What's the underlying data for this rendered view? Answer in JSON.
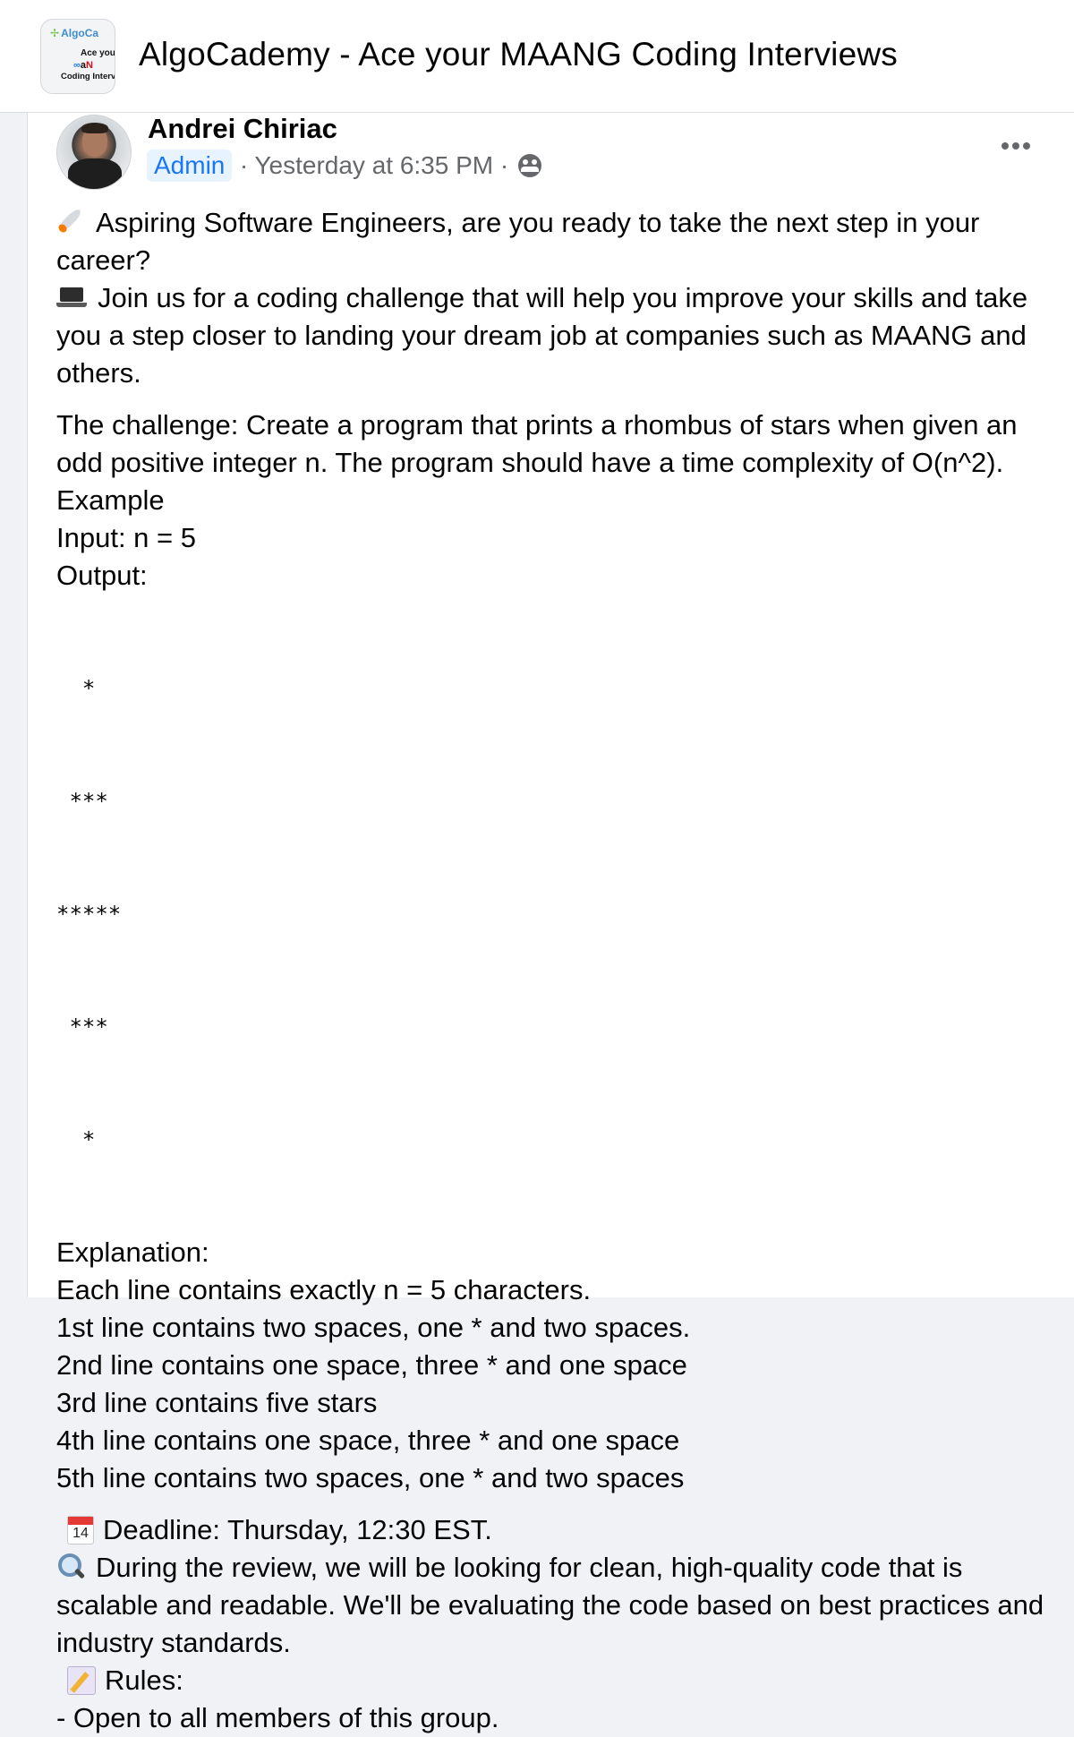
{
  "group": {
    "title": "AlgoCademy - Ace your MAANG Coding Interviews",
    "thumb": {
      "logo_text": "AlgoCa",
      "tagline": "Ace you",
      "brands": [
        "∞",
        "",
        "a",
        "N"
      ],
      "coding": "Coding Interv"
    }
  },
  "post": {
    "author": "Andrei Chiriac",
    "badge": "Admin",
    "timestamp": "· Yesterday at 6:35 PM ·",
    "icons": {
      "more": "more-options-icon",
      "audience": "group-audience-icon"
    },
    "paragraphs": {
      "intro1": "Aspiring Software Engineers, are you ready to take the next step in your career?",
      "intro2": "Join us for a coding challenge that will help you improve your skills and take you a step closer to landing your dream job at companies such as MAANG and others.",
      "challenge": "The challenge: Create a program that prints a rhombus of stars when given an odd positive integer n. The program should have a time complexity of O(n^2).",
      "example": "Example",
      "input": "Input: n = 5",
      "output": "Output:",
      "stars": [
        "  *",
        " ***",
        "*****",
        " ***",
        "  *"
      ],
      "explanation": "Explanation:",
      "explain_lines": [
        "Each line contains exactly n = 5 characters.",
        "1st line contains two spaces, one * and two spaces.",
        "2nd line contains one space, three * and one space",
        "3rd line contains five stars",
        "4th line contains one space, three * and one space",
        "5th line contains two spaces, one * and two spaces"
      ],
      "deadline": "Deadline: Thursday, 12:30 EST.",
      "calendar_day": "14",
      "review": "During the review, we will be looking for clean, high-quality code that is scalable and readable. We'll be evaluating the code based on best practices and industry standards.",
      "rules": "Rules:",
      "rule1": "- Open to all members of this group."
    }
  }
}
